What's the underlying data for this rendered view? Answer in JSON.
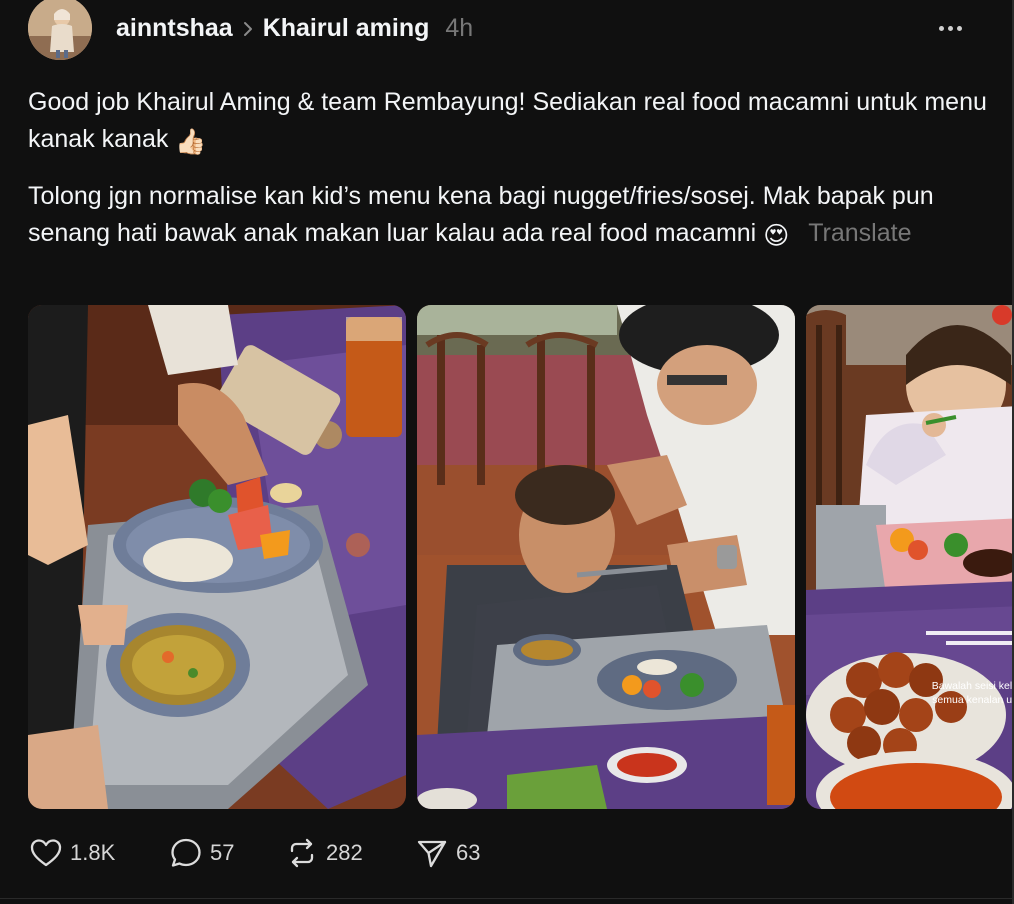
{
  "post": {
    "author": "ainntshaa",
    "community": "Khairul aming",
    "time": "4h",
    "paragraph1_text": "Good job Khairul Aming & team Rembayung! Sediakan real food macamni untuk menu kanak kanak",
    "paragraph1_emoji": "👍🏻",
    "paragraph2_text": "Tolong jgn normalise kan kid’s menu kena bagi nugget/fries/sosej. Mak bapak pun senang hati bawak anak makan luar kalau ada real food macamni",
    "paragraph2_emoji": "😍",
    "translate_label": "Translate",
    "photo_caption": {
      "line1": "Bawalah seisi keluarga,",
      "line2": "semua kenalan untuk"
    }
  },
  "actions": {
    "likes": "1.8K",
    "replies": "57",
    "reposts": "282",
    "shares": "63"
  },
  "icons": {
    "more": "more-horizontal-icon",
    "chevron": "chevron-right-icon",
    "like": "heart-icon",
    "reply": "speech-bubble-icon",
    "repost": "repost-arrows-icon",
    "share": "paper-plane-icon"
  },
  "colors": {
    "background": "#101010",
    "text": "#f3f5f7",
    "muted": "#777777"
  }
}
